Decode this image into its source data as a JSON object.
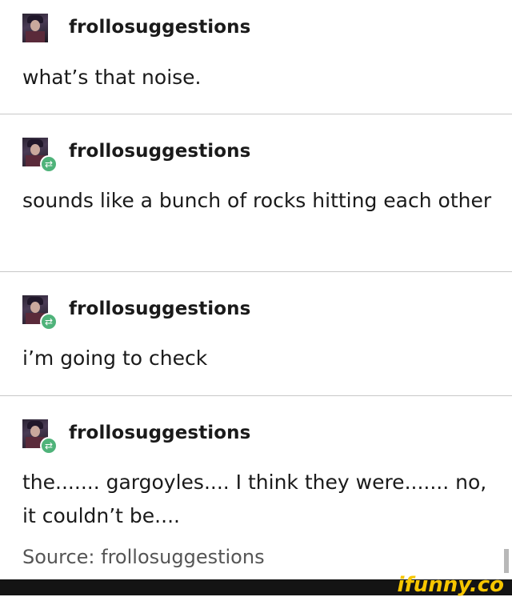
{
  "posts": [
    {
      "username": "frollosuggestions",
      "text": "what’s that noise.",
      "reblog": false
    },
    {
      "username": "frollosuggestions",
      "text": "sounds like a bunch of rocks hitting each other",
      "reblog": true
    },
    {
      "username": "frollosuggestions",
      "text": "i’m going to check",
      "reblog": true
    },
    {
      "username": "frollosuggestions",
      "text": "the....... gargoyles.... I think they were....... no, it couldn’t be....",
      "reblog": true
    }
  ],
  "source": "Source: frollosuggestions",
  "watermark": "ifunny.co",
  "colors": {
    "reblog_badge": "#4fb37a",
    "brand": "#f7c600"
  },
  "icons": {
    "avatar": "avatar-icon",
    "reblog": "reblog-icon"
  }
}
